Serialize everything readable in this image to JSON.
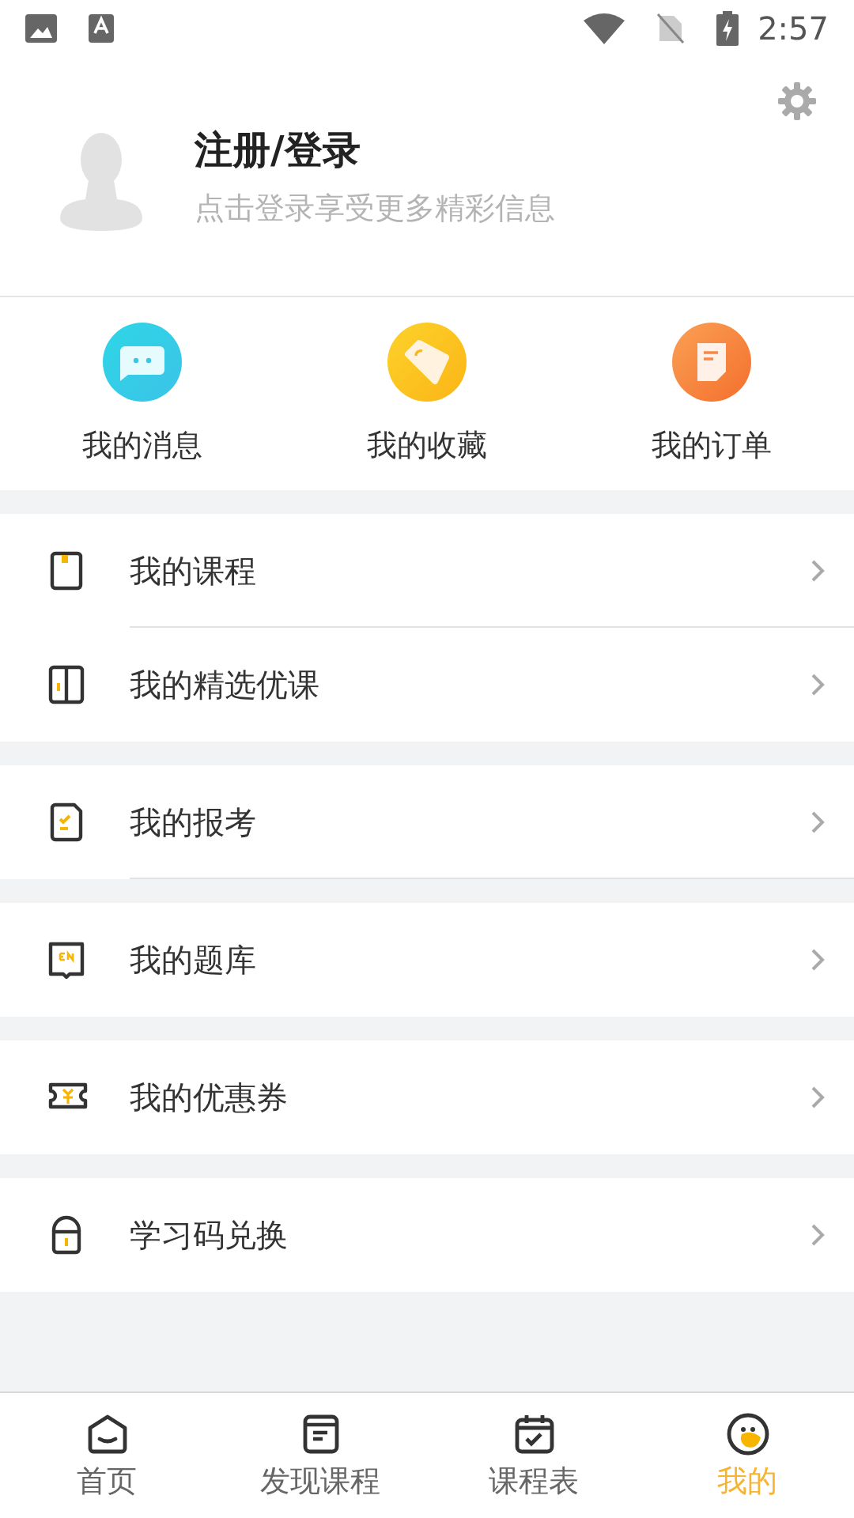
{
  "status_bar": {
    "time": "2:57"
  },
  "profile": {
    "title": "注册/登录",
    "subtitle": "点击登录享受更多精彩信息"
  },
  "shortcuts": [
    {
      "label": "我的消息",
      "kind": "message"
    },
    {
      "label": "我的收藏",
      "kind": "favorite"
    },
    {
      "label": "我的订单",
      "kind": "order"
    }
  ],
  "menu_groups": [
    {
      "items": [
        {
          "label": "我的课程",
          "kind": "course"
        },
        {
          "label": "我的精选优课",
          "kind": "book"
        }
      ]
    },
    {
      "items": [
        {
          "label": "我的报考",
          "kind": "exam"
        }
      ]
    },
    {
      "items": [
        {
          "label": "我的题库",
          "kind": "bank"
        }
      ]
    },
    {
      "items": [
        {
          "label": "我的优惠券",
          "kind": "coupon"
        }
      ]
    },
    {
      "items": [
        {
          "label": "学习码兑换",
          "kind": "code"
        }
      ]
    }
  ],
  "tab_bar": [
    {
      "label": "首页",
      "kind": "home",
      "selected": false
    },
    {
      "label": "发现课程",
      "kind": "discover",
      "selected": false
    },
    {
      "label": "课程表",
      "kind": "schedule",
      "selected": false
    },
    {
      "label": "我的",
      "kind": "me",
      "selected": true
    }
  ]
}
